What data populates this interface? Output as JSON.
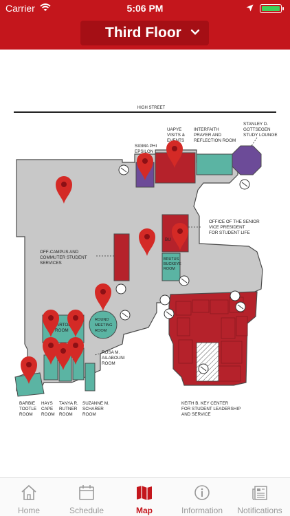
{
  "status_bar": {
    "carrier": "Carrier",
    "time": "5:06 PM",
    "battery_level": 1.0
  },
  "header": {
    "floor_title": "Third Floor"
  },
  "map": {
    "street": "HIGH STREET",
    "labels": {
      "stanley": [
        "STANLEY D.",
        "GOTTSEGEN",
        "STUDY LOUNGE"
      ],
      "interfaith": [
        "INTERFAITH",
        "PRAYER AND",
        "REFLECTION ROOM"
      ],
      "uapye": [
        "UAPYE",
        "VISITS &",
        "EVENTS"
      ],
      "sigma": [
        "SIGMA PHI",
        "EPSILON"
      ],
      "office": [
        "OFFICE OF THE SENIOR",
        "VICE PRESIDENT",
        "FOR STUDENT LIFE"
      ],
      "offcampus": [
        "OFF-CAMPUS AND",
        "COMMUTER STUDENT",
        "SERVICES"
      ],
      "brutus": [
        "BRUTUS",
        "BUCKEYE",
        "ROOM"
      ],
      "round": [
        "ROUND",
        "MEETING",
        "ROOM"
      ],
      "rosa": [
        "ROSA M.",
        "AILABOUNI",
        "ROOM"
      ],
      "keith": [
        "KEITH B. KEY CENTER",
        "FOR STUDENT LEADERSHIP",
        "AND SERVICE"
      ],
      "barbie": [
        "BARBIE",
        "TOOTLE",
        "ROOM"
      ],
      "hays": [
        "HAYS",
        "CAPE",
        "ROOM"
      ],
      "tanya": [
        "TANYA R.",
        "RUTNER",
        "ROOM"
      ],
      "suzanne": [
        "SUZANNE M.",
        "SCHARER",
        "ROOM"
      ],
      "partial_artoe": "ARTOE",
      "partial_room": "ROOM",
      "partial_bu": "BU"
    }
  },
  "tabs": [
    {
      "label": "Home",
      "icon": "home-icon",
      "active": false
    },
    {
      "label": "Schedule",
      "icon": "calendar-icon",
      "active": false
    },
    {
      "label": "Map",
      "icon": "map-icon",
      "active": true
    },
    {
      "label": "Information",
      "icon": "info-icon",
      "active": false
    },
    {
      "label": "Notifications",
      "icon": "newspaper-icon",
      "active": false
    }
  ],
  "colors": {
    "brand_red": "#c4161c",
    "room_red": "#b5222b",
    "teal": "#5bb4a3",
    "purple": "#6c4b98",
    "floor_gray": "#c9c9c9",
    "pin_red": "#d42a26"
  }
}
